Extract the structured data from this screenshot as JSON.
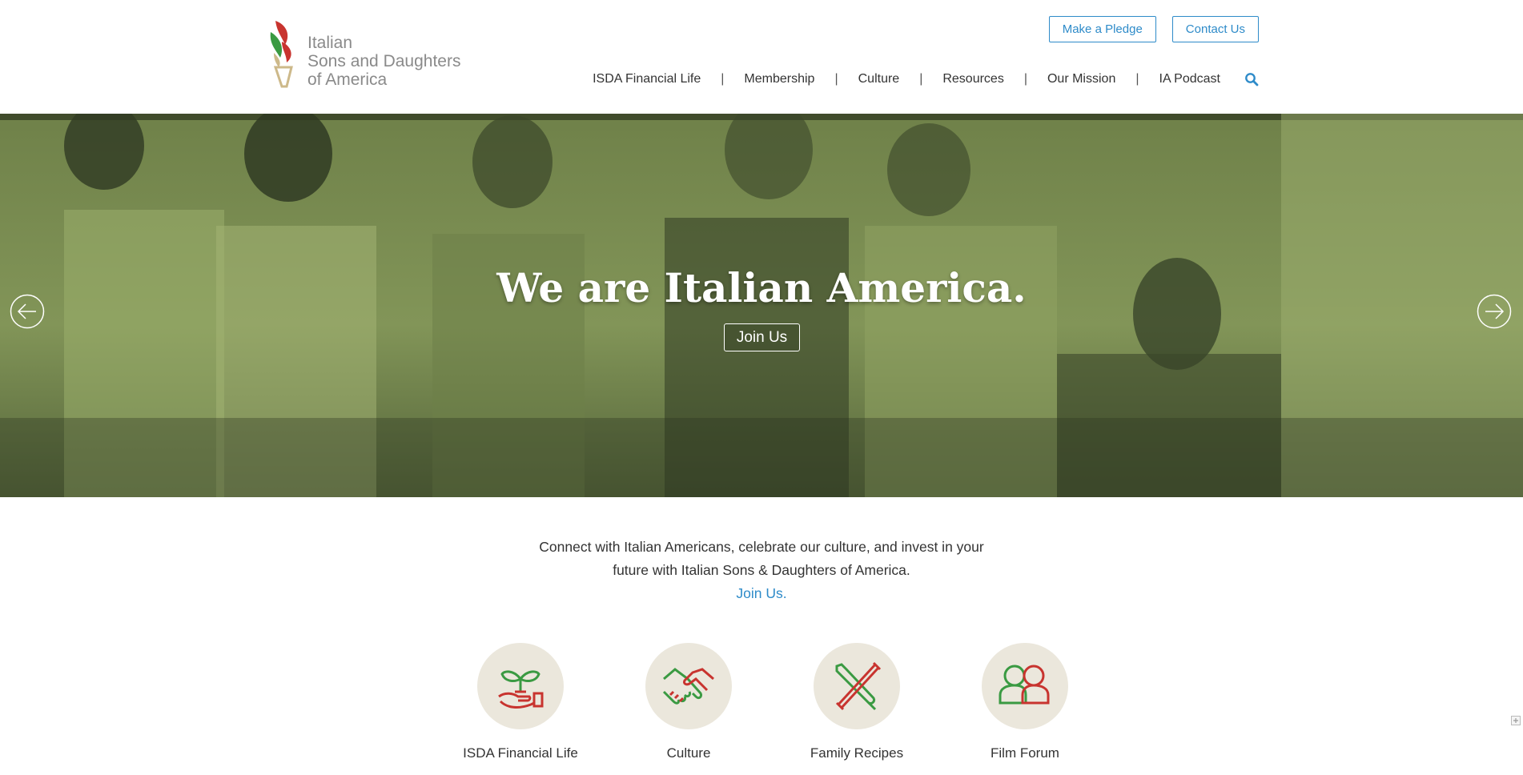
{
  "brand": {
    "name_line1": "Italian",
    "name_line2": "Sons and Daughters",
    "name_line3": "of America",
    "colors": {
      "green": "#3a9a42",
      "red": "#c8342f",
      "gold": "#cdb98a",
      "accent_blue": "#2e8bc9"
    }
  },
  "top_buttons": {
    "pledge": "Make a Pledge",
    "contact": "Contact Us"
  },
  "nav": {
    "items": [
      "ISDA Financial Life",
      "Membership",
      "Culture",
      "Resources",
      "Our Mission",
      "IA Podcast"
    ],
    "separator": "|",
    "search_icon": "search-icon"
  },
  "hero": {
    "title": "We are Italian America.",
    "button": "Join Us",
    "prev_icon": "arrow-left-icon",
    "next_icon": "arrow-right-icon",
    "tint_color": "#7d8f59"
  },
  "intro": {
    "line1": "Connect with Italian Americans, celebrate our culture, and invest in your",
    "line2": "future with Italian Sons & Daughters of America.",
    "link": "Join Us."
  },
  "features": [
    {
      "label": "ISDA Financial Life",
      "icon": "plant-in-hand-icon"
    },
    {
      "label": "Culture",
      "icon": "handshake-icon"
    },
    {
      "label": "Family Recipes",
      "icon": "crossed-rolling-pin-icon"
    },
    {
      "label": "Film Forum",
      "icon": "two-people-icon"
    }
  ]
}
